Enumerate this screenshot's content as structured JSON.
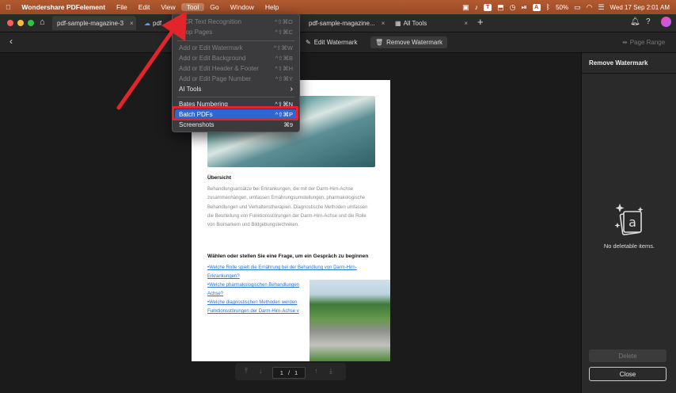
{
  "menubar": {
    "app_name": "Wondershare PDFelement",
    "items": [
      "File",
      "Edit",
      "View",
      "Tool",
      "Go",
      "Window",
      "Help"
    ],
    "battery": "50%",
    "clock": "Wed 17 Sep  2:01 AM"
  },
  "tabs": [
    {
      "label": "pdf-sample-magazine-3",
      "close": "×"
    },
    {
      "label": "pdf",
      "close": ""
    },
    {
      "label": "pdf-sample-magazine...",
      "close": "×"
    },
    {
      "label": "All Tools",
      "close": "×"
    }
  ],
  "toolbar": {
    "edit_watermark": "Edit Watermark",
    "remove_watermark": "Remove Watermark",
    "page_range": "Page Range"
  },
  "menu": {
    "items": [
      {
        "label": "OCR Text Recognition",
        "shortcut": "^⇧⌘O"
      },
      {
        "label": "Crop Pages",
        "shortcut": "^⇧⌘C"
      },
      {
        "label": "Add or Edit Watermark",
        "shortcut": "^⇧⌘W"
      },
      {
        "label": "Add or Edit Background",
        "shortcut": "^⇧⌘B"
      },
      {
        "label": "Add or Edit Header & Footer",
        "shortcut": "^⇧⌘H"
      },
      {
        "label": "Add or Edit Page Number",
        "shortcut": "^⇧⌘Y"
      },
      {
        "label": "AI Tools",
        "shortcut": "›"
      },
      {
        "label": "Bates Numbering",
        "shortcut": "^⇧⌘N"
      },
      {
        "label": "Batch PDFs",
        "shortcut": "^⇧⌘P"
      },
      {
        "label": "Screenshots",
        "shortcut": "⌘9"
      }
    ]
  },
  "document": {
    "heading1": "Übersicht",
    "paragraph": "Behandlungsansätze bei Erkrankungen, die mit der Darm-Hirn-Achse zusammenhängen, umfassen Ernährungsumstellungen, pharmakologische Behandlungen und Verhaltenstherapien. Diagnostische Methoden umfassen die Beurteilung von Funktionsstörungen der Darm-Hirn-Achse und die Rolle von Biomarkern und Bildgebungstechniken.",
    "heading2": "Wählen oder stellen Sie eine Frage, um ein Gespräch zu beginnen",
    "links": [
      "•Welche Rolle spielt die Ernährung bei der Behandlung von Darm-Hirn-",
      "Erkrankungen?",
      "•Welche pharmakologischen Behandlungen",
      "Achse?",
      "•Welche diagnostischen Methoden werden",
      "Funktionsstörungen der Darm-Hirn-Achse v"
    ]
  },
  "pager": {
    "current": "1",
    "separator": "/",
    "total": "1"
  },
  "panel": {
    "title": "Remove Watermark",
    "empty_text": "No deletable items.",
    "delete_label": "Delete",
    "close_label": "Close"
  },
  "colors": {
    "accent": "#2e67d1",
    "highlight_box": "#e0252b",
    "arrow": "#e0252b",
    "menubar": "#a2502a"
  }
}
